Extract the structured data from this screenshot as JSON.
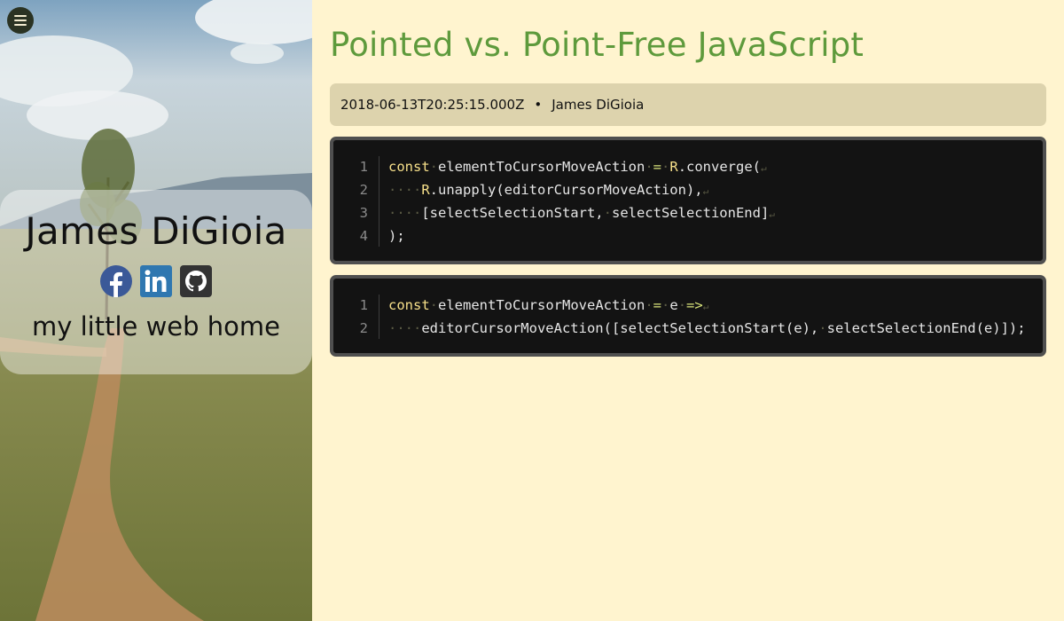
{
  "sidebar": {
    "name": "James DiGioia",
    "tagline": "my little web home",
    "social": [
      {
        "icon": "facebook-icon",
        "color": "#3b5998"
      },
      {
        "icon": "linkedin-icon",
        "color": "#2f77b0"
      },
      {
        "icon": "github-icon",
        "color": "#333333"
      }
    ]
  },
  "post": {
    "title": "Pointed vs. Point-Free JavaScript",
    "date": "2018-06-13T20:25:15.000Z",
    "separator": "•",
    "author": "James DiGioia"
  },
  "code_blocks": [
    {
      "lines": [
        {
          "n": "1",
          "parts": [
            [
              "kw",
              "const"
            ],
            [
              "ws",
              "·"
            ],
            [
              "t",
              "elementToCursorMoveAction"
            ],
            [
              "ws",
              "·"
            ],
            [
              "op",
              "="
            ],
            [
              "ws",
              "·"
            ],
            [
              "cn",
              "R"
            ],
            [
              "t",
              ".converge("
            ],
            [
              "eol",
              "↵"
            ]
          ]
        },
        {
          "n": "2",
          "parts": [
            [
              "ws",
              "····"
            ],
            [
              "cn",
              "R"
            ],
            [
              "t",
              ".unapply(editorCursorMoveAction),"
            ],
            [
              "eol",
              "↵"
            ]
          ]
        },
        {
          "n": "3",
          "parts": [
            [
              "ws",
              "····"
            ],
            [
              "t",
              "[selectSelectionStart,"
            ],
            [
              "ws",
              "·"
            ],
            [
              "t",
              "selectSelectionEnd]"
            ],
            [
              "eol",
              "↵"
            ]
          ]
        },
        {
          "n": "4",
          "parts": [
            [
              "t",
              ");"
            ]
          ]
        }
      ]
    },
    {
      "lines": [
        {
          "n": "1",
          "parts": [
            [
              "kw",
              "const"
            ],
            [
              "ws",
              "·"
            ],
            [
              "t",
              "elementToCursorMoveAction"
            ],
            [
              "ws",
              "·"
            ],
            [
              "op",
              "="
            ],
            [
              "ws",
              "·"
            ],
            [
              "t",
              "e"
            ],
            [
              "ws",
              "·"
            ],
            [
              "op",
              "=>"
            ],
            [
              "eol",
              "↵"
            ]
          ]
        },
        {
          "n": "2",
          "parts": [
            [
              "ws",
              "····"
            ],
            [
              "t",
              "editorCursorMoveAction([selectSelectionStart(e),"
            ],
            [
              "ws",
              "·"
            ],
            [
              "t",
              "selectSelectionEnd(e)]);"
            ]
          ]
        }
      ]
    }
  ]
}
